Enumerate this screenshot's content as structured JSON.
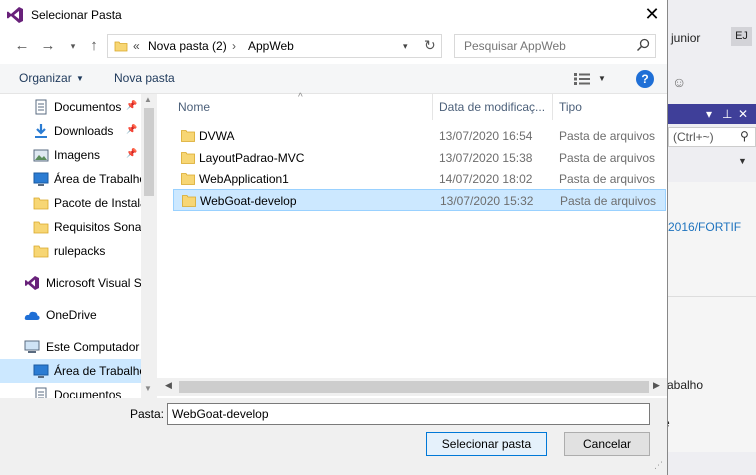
{
  "dialog": {
    "title": "Selecionar Pasta",
    "close_glyph": "✕"
  },
  "address": {
    "chevron": "«",
    "parts": [
      "Nova pasta (2)",
      "AppWeb"
    ],
    "separator": "›"
  },
  "search": {
    "placeholder": "Pesquisar AppWeb"
  },
  "toolbar": {
    "organize_label": "Organizar",
    "new_folder_label": "Nova pasta",
    "help_label": "?"
  },
  "nav_pane": {
    "items": [
      {
        "label": "Documentos",
        "icon": "documents-icon",
        "pinned": true
      },
      {
        "label": "Downloads",
        "icon": "downloads-icon",
        "pinned": true
      },
      {
        "label": "Imagens",
        "icon": "pictures-icon",
        "pinned": true
      },
      {
        "label": "Área de Trabalho",
        "icon": "desktop-icon",
        "pinned": false
      },
      {
        "label": "Pacote de Instalação",
        "icon": "folder-icon",
        "pinned": false
      },
      {
        "label": "Requisitos Sonar",
        "icon": "folder-icon",
        "pinned": false
      },
      {
        "label": "rulepacks",
        "icon": "folder-icon",
        "pinned": false
      },
      {
        "label": "Microsoft Visual S",
        "icon": "visual-studio-icon",
        "pinned": false
      },
      {
        "label": "OneDrive",
        "icon": "onedrive-icon",
        "pinned": false
      },
      {
        "label": "Este Computador",
        "icon": "computer-icon",
        "pinned": false
      },
      {
        "label": "Área de Trabalho",
        "icon": "desktop-icon",
        "pinned": false,
        "selected": true
      },
      {
        "label": "Documentos",
        "icon": "documents-icon",
        "pinned": false
      }
    ]
  },
  "file_list": {
    "columns": [
      "Nome",
      "Data de modificaç...",
      "Tipo"
    ],
    "rows": [
      {
        "name": "DVWA",
        "date": "13/07/2020 16:54",
        "type": "Pasta de arquivos"
      },
      {
        "name": "LayoutPadrao-MVC",
        "date": "13/07/2020 15:38",
        "type": "Pasta de arquivos"
      },
      {
        "name": "WebApplication1",
        "date": "14/07/2020 18:02",
        "type": "Pasta de arquivos"
      },
      {
        "name": "WebGoat-develop",
        "date": "13/07/2020 15:32",
        "type": "Pasta de arquivos",
        "selected": true
      }
    ]
  },
  "footer": {
    "folder_label": "Pasta:",
    "folder_value": "WebGoat-develop",
    "select_label": "Selecionar pasta",
    "cancel_label": "Cancelar"
  },
  "background_window": {
    "user_name": "n junior",
    "avatar_initials": "EJ",
    "search_hint": "(Ctrl+~)",
    "path_fragment": "2016/FORTIF",
    "row1": "r",
    "row2": "rabalho",
    "row3": "e"
  },
  "colors": {
    "accent": "#0078d7",
    "selection": "#cce8ff",
    "folder": "#f7d674",
    "vs_purple": "#68217a"
  }
}
